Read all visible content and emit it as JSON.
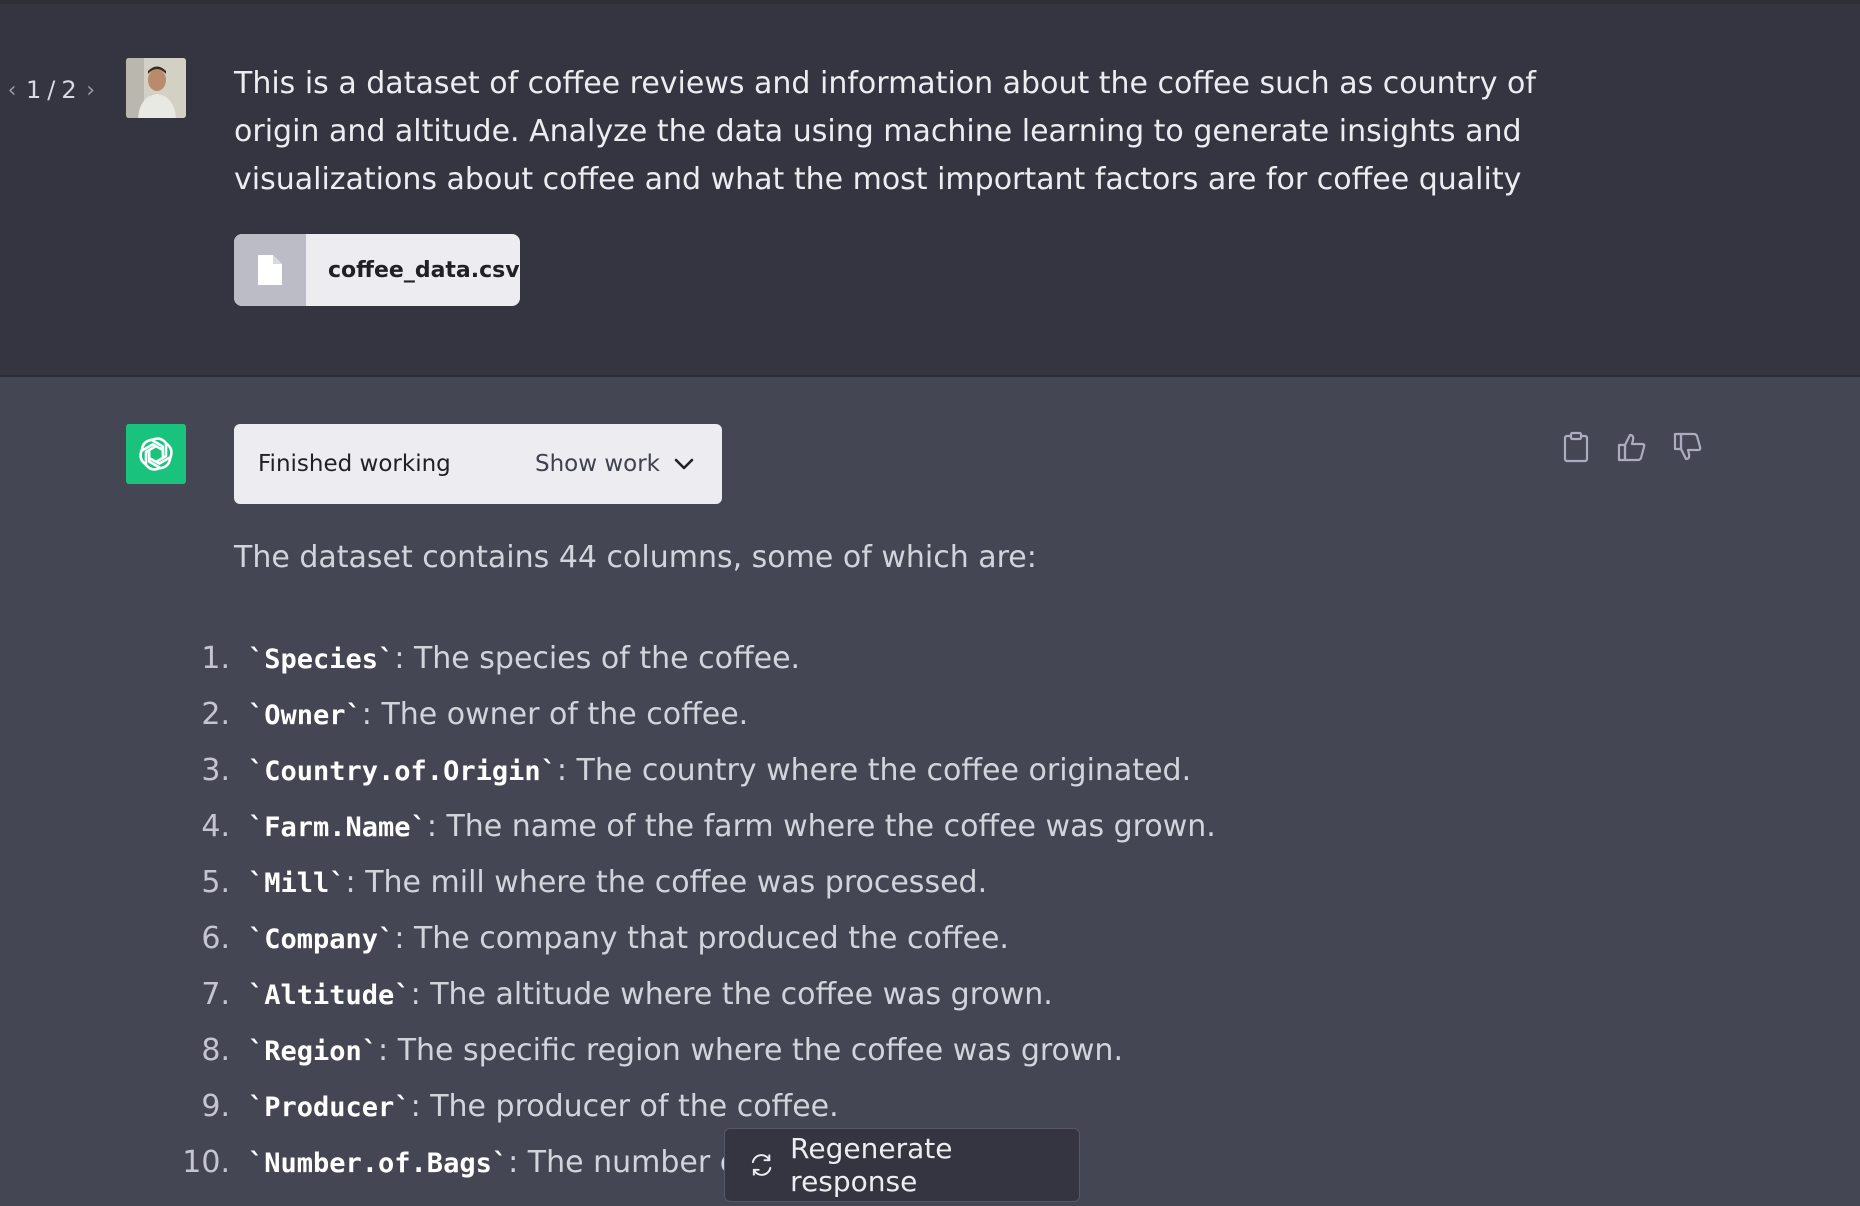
{
  "user_message": {
    "pager": {
      "current": "1",
      "separator": "/",
      "total": "2",
      "prev_icon": "chevron-left-icon",
      "next_icon": "chevron-right-icon"
    },
    "text": "This is a dataset of coffee reviews and information about the coffee such as country of origin and altitude. Analyze the data using machine learning to generate insights and visualizations about coffee and what the most important factors are for coffee quality",
    "attachment": {
      "filename": "coffee_data.csv",
      "icon": "file-icon"
    }
  },
  "assistant_message": {
    "status": {
      "label": "Finished working",
      "toggle_label": "Show work",
      "toggle_icon": "chevron-down-icon"
    },
    "actions": {
      "copy": "clipboard-icon",
      "like": "thumbs-up-icon",
      "dislike": "thumbs-down-icon"
    },
    "intro": "The dataset contains 44 columns, some of which are:",
    "columns": [
      {
        "num": "1.",
        "code": "`Species`",
        "desc": ": The species of the coffee."
      },
      {
        "num": "2.",
        "code": "`Owner`",
        "desc": ": The owner of the coffee."
      },
      {
        "num": "3.",
        "code": "`Country.of.Origin`",
        "desc": ": The country where the coffee originated."
      },
      {
        "num": "4.",
        "code": "`Farm.Name`",
        "desc": ": The name of the farm where the coffee was grown."
      },
      {
        "num": "5.",
        "code": "`Mill`",
        "desc": ": The mill where the coffee was processed."
      },
      {
        "num": "6.",
        "code": "`Company`",
        "desc": ": The company that produced the coffee."
      },
      {
        "num": "7.",
        "code": "`Altitude`",
        "desc": ": The altitude where the coffee was grown."
      },
      {
        "num": "8.",
        "code": "`Region`",
        "desc": ": The specific region where the coffee was grown."
      },
      {
        "num": "9.",
        "code": "`Producer`",
        "desc": ": The producer of the coffee."
      },
      {
        "num": "10.",
        "code": "`Number.of.Bags`",
        "desc": ": The number c"
      }
    ]
  },
  "regenerate": {
    "label": "Regenerate response",
    "icon": "refresh-icon"
  },
  "colors": {
    "user_bg": "#343541",
    "assistant_bg": "#444654",
    "gpt_green": "#19c37d"
  }
}
